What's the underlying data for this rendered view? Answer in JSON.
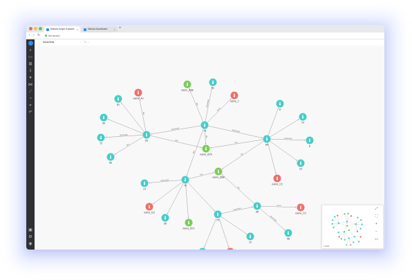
{
  "browser": {
    "tabs": [
      {
        "label": "Nebula Graph Explorer",
        "active": true
      },
      {
        "label": "Nebula Dashboard",
        "active": false
      }
    ],
    "new_tab": "+",
    "url": "Not secure |"
  },
  "subheader": {
    "title": "basketball"
  },
  "sidebar": {
    "icons": [
      "logo-icon",
      "search-icon",
      "console-icon",
      "schema-icon",
      "import-icon",
      "explore-icon",
      "graph-icon",
      "algorithm-icon",
      "tag-icon",
      "filter-icon",
      "history-icon",
      "help-icon",
      "settings-icon",
      "user-icon"
    ]
  },
  "colors": {
    "teal": "#47cdc8",
    "green": "#7ccc58",
    "red": "#ef6f6b",
    "edge": "#9a9a9a"
  },
  "graph": {
    "node_labels": {
      "n_player_a": "name_Bar",
      "n_green_top": "name_A88",
      "n_red_top": "name_J",
      "n_top_right": "81",
      "n_red_upperleft": "name_AJ",
      "n_upper_left1": "81",
      "n_left1": "50",
      "n_left2": "72",
      "n_left3": "80",
      "n_hub_left": "83",
      "n_hub_center": "73",
      "n_green_center": "name_B76",
      "n_hub_right": "84",
      "n_right1": "8",
      "n_right2": "70",
      "n_right3": "8",
      "n_right4": "23",
      "n_red_right": "name_C2",
      "n_green_mid": "name_B88",
      "n_14": "14",
      "n_hub_lower": "78",
      "n_red_lower": "name_Ed",
      "n_56": "56",
      "n_green_lower": "name_B71",
      "n_hub_bottom": "79",
      "n_hub_br": "85",
      "n_red_br": "name_C2",
      "n_98": "98",
      "n_90": "90",
      "n_red_bottom": "name_Ce",
      "n_12": "12",
      "n_26": "26"
    },
    "edge_labels": {
      "serve1": "serve",
      "serve2": "serve",
      "team1": "teammate",
      "team2": "teammate",
      "team3": "teammate",
      "team4": "teammate",
      "team5": "teammate",
      "team6": "teammate",
      "team7": "teammate",
      "team8": "teammate",
      "like1": "like",
      "like2": "like",
      "like3": "like",
      "like4": "like",
      "like5": "like",
      "like6": "like",
      "like7": "like",
      "like8": "like",
      "like9": "like",
      "like10": "like"
    }
  },
  "minimap": {
    "zoom": "1.00%",
    "controls": [
      "fit-icon",
      "fullscreen-icon",
      "zoom-in-icon",
      "zoom-out-icon",
      "reset-icon"
    ]
  }
}
